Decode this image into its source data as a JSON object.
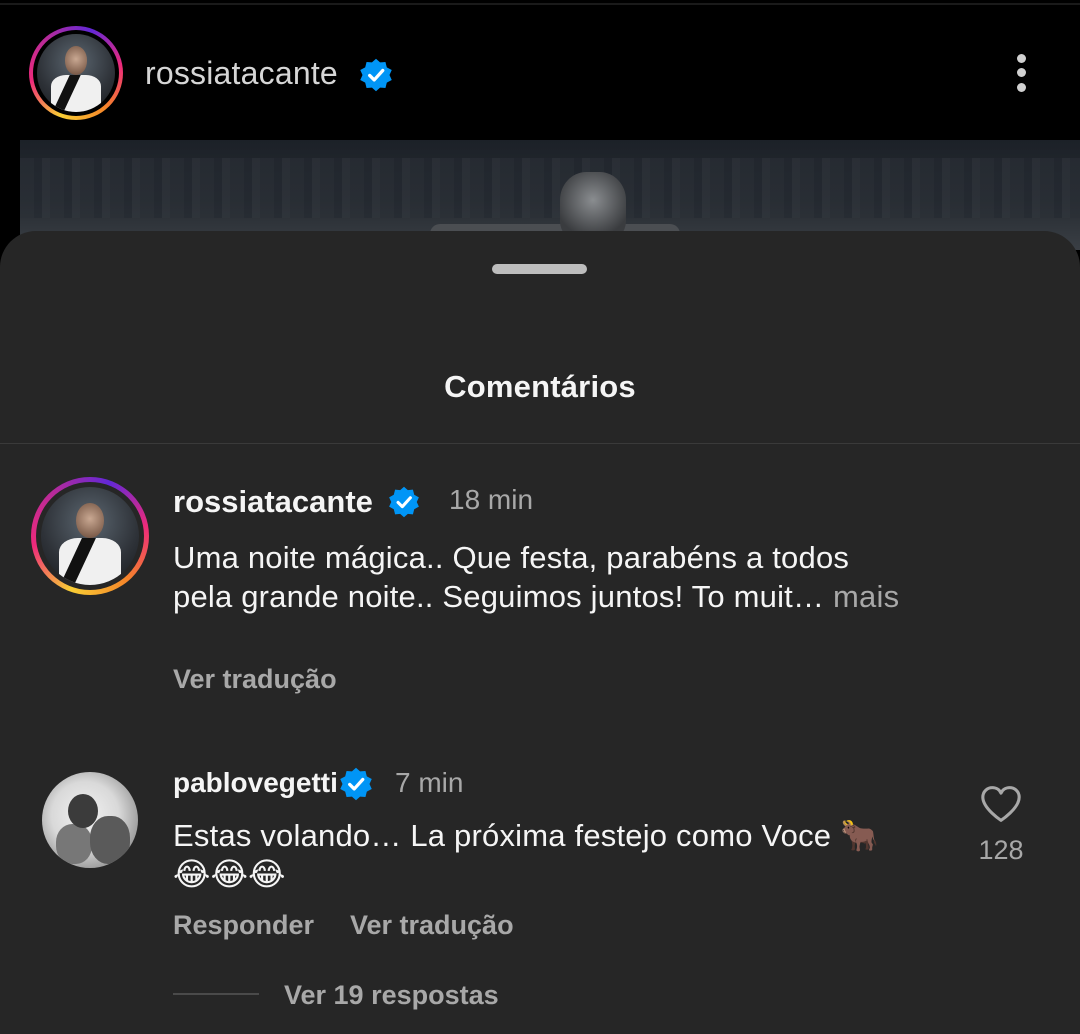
{
  "post": {
    "username": "rossiatacante",
    "verified": true,
    "menu_icon": "more-vertical-icon"
  },
  "sheet": {
    "title": "Comentários"
  },
  "comments": [
    {
      "username": "rossiatacante",
      "verified": true,
      "time": "18 min",
      "text_line1": "Uma noite mágica.. Que festa, parabéns a todos",
      "text_line2": "pela grande noite.. Seguimos juntos! To muit…",
      "more_label": " mais",
      "translate_label": "Ver tradução"
    },
    {
      "username": "pablovegetti",
      "verified": true,
      "time": "7 min",
      "text_line1": "Estas volando… La próxima festejo como Voce 🐂",
      "text_line2": "😂😂😂",
      "reply_label": "Responder",
      "translate_label": "Ver tradução",
      "like_count": "128",
      "replies_label": "Ver 19 respostas"
    }
  ],
  "colors": {
    "background": "#000000",
    "sheet": "#262626",
    "verified_blue": "#0095f6",
    "secondary_text": "#a8a8a8"
  }
}
